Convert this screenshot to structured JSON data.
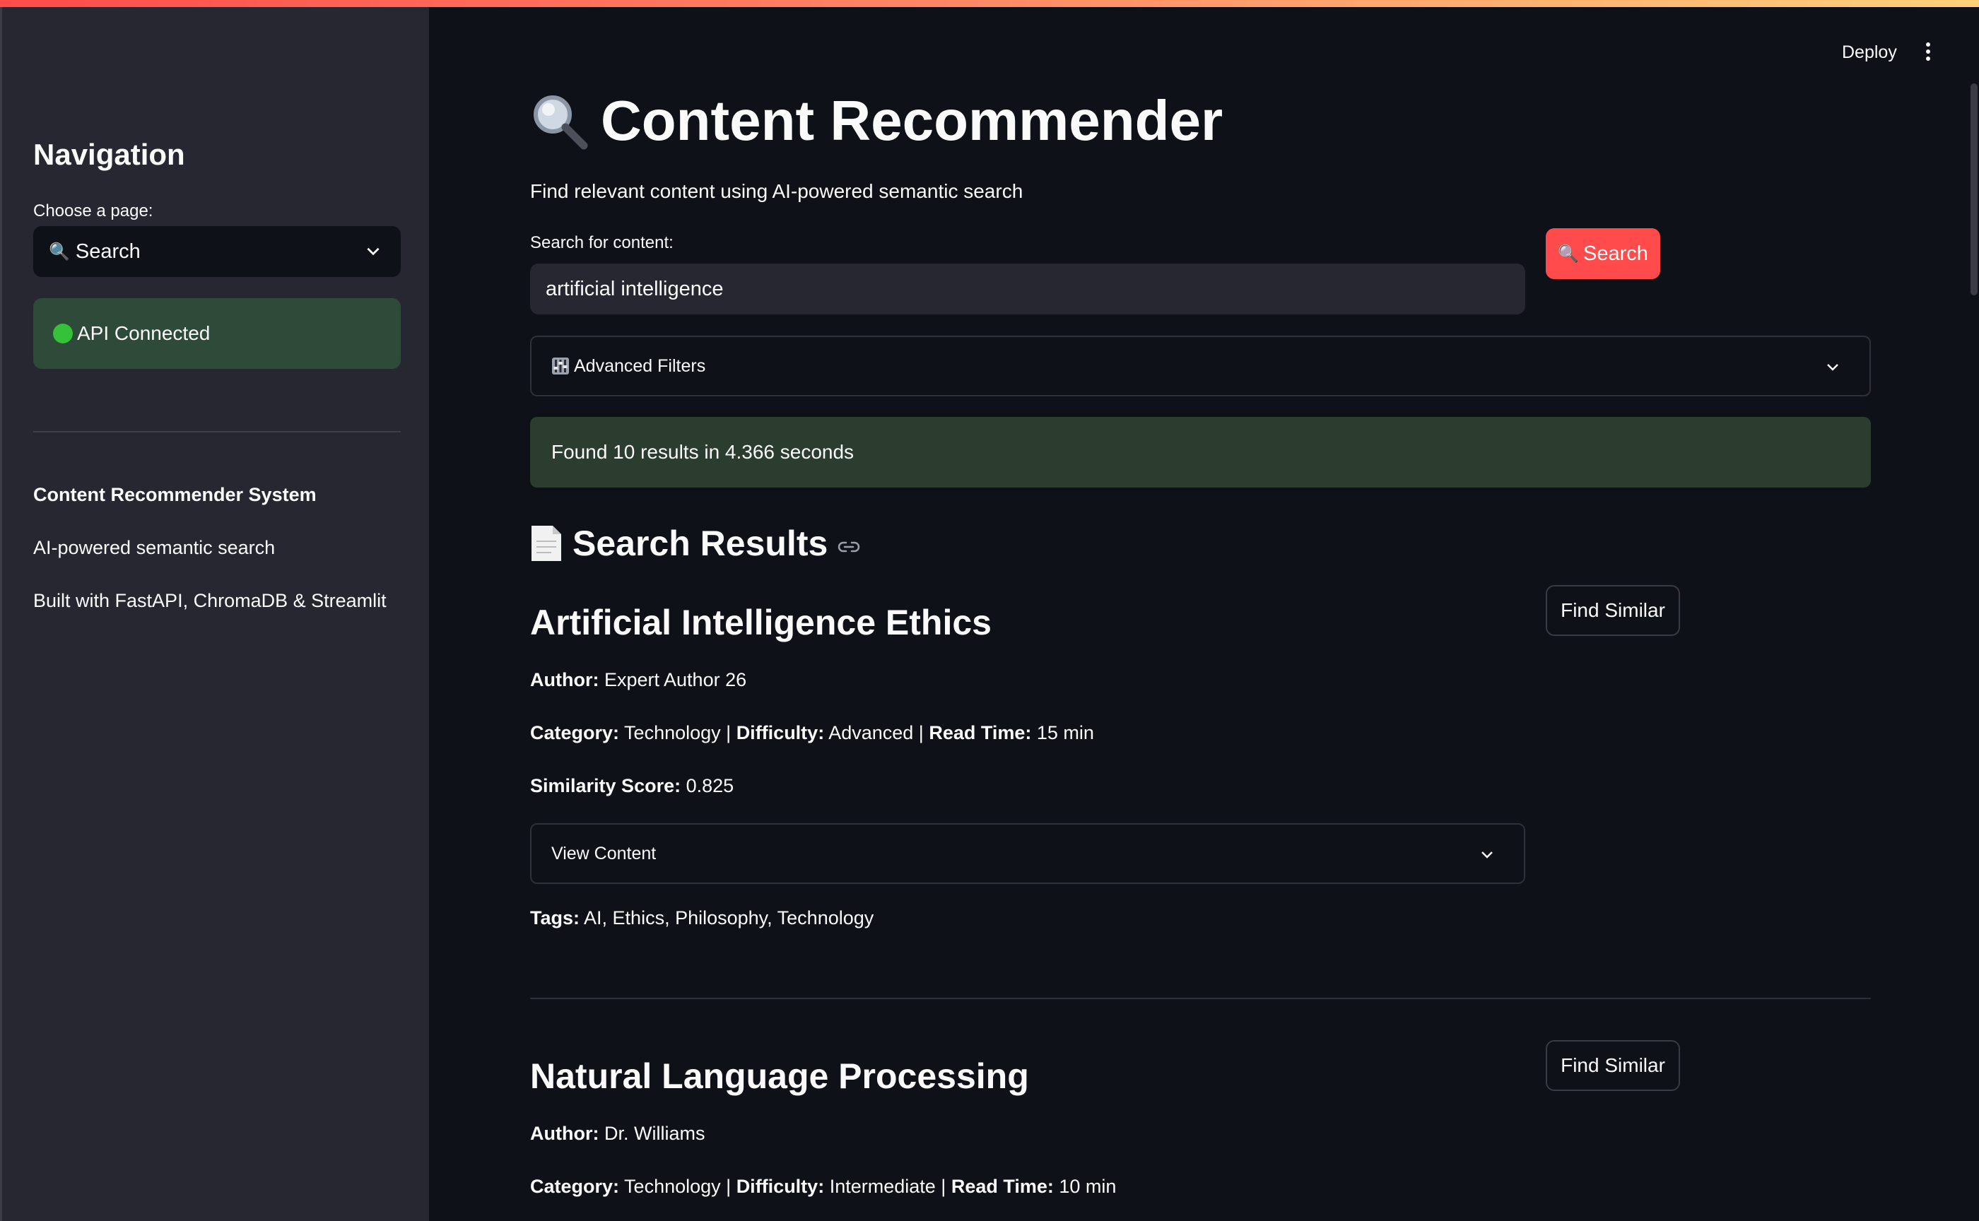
{
  "header": {
    "deploy_label": "Deploy"
  },
  "sidebar": {
    "title": "Navigation",
    "choose_label": "Choose a page:",
    "selected_page": "Search",
    "api_status": "API Connected",
    "system_name": "Content Recommender System",
    "tagline": "AI-powered semantic search",
    "built_with": "Built with FastAPI, ChromaDB & Streamlit"
  },
  "main": {
    "title": "Content Recommender",
    "subtitle": "Find relevant content using AI-powered semantic search",
    "search_label": "Search for content:",
    "search_value": "artificial intelligence",
    "search_button": "Search",
    "advanced_filters": "Advanced Filters",
    "found_message": "Found 10 results in 4.366 seconds",
    "results_heading": "Search Results"
  },
  "labels": {
    "author": "Author:",
    "category": "Category:",
    "difficulty": "Difficulty:",
    "read_time": "Read Time:",
    "similarity": "Similarity Score:",
    "tags": "Tags:",
    "view_content": "View Content",
    "find_similar": "Find Similar"
  },
  "results": [
    {
      "title": "Artificial Intelligence Ethics",
      "author": "Expert Author 26",
      "category": "Technology",
      "difficulty": "Advanced",
      "read_time": "15 min",
      "similarity": "0.825",
      "tags": "AI, Ethics, Philosophy, Technology"
    },
    {
      "title": "Natural Language Processing",
      "author": "Dr. Williams",
      "category": "Technology",
      "difficulty": "Intermediate",
      "read_time": "10 min"
    }
  ],
  "colors": {
    "background": "#0e1117",
    "sidebar": "#262730",
    "primary": "#ff4b4b",
    "success_bg": "#2e4a38"
  }
}
